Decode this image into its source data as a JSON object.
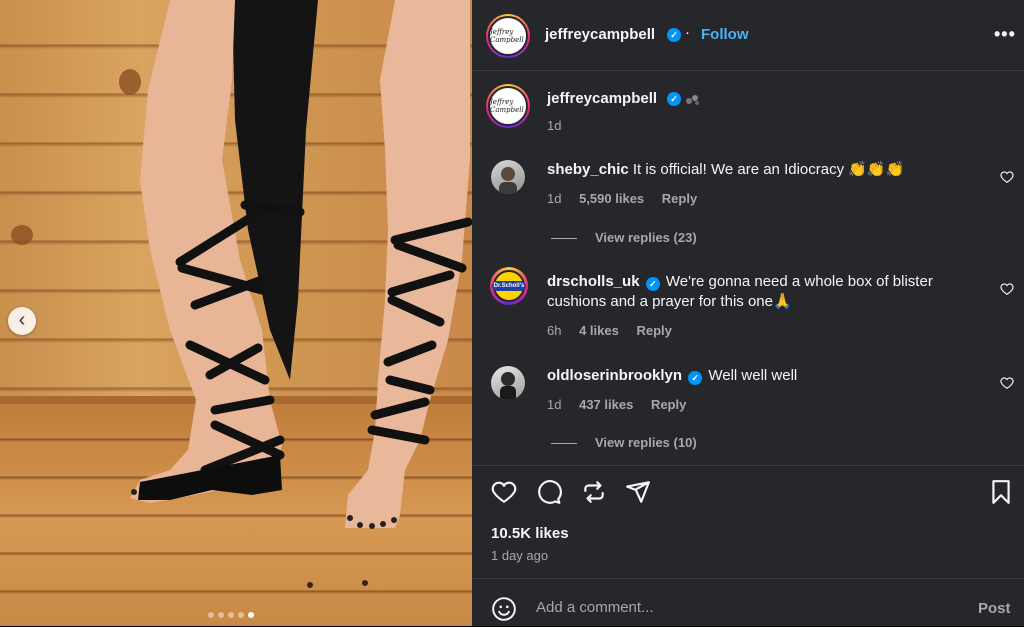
{
  "post": {
    "author": "jeffreycampbell",
    "avatar_text": "Jeffrey Campbell",
    "follow_label": "Follow",
    "separator": "·",
    "more_label": "•••",
    "caption_time": "1d",
    "carousel": {
      "count": 5,
      "active_index": 4
    }
  },
  "comments": [
    {
      "user": "sheby_chic",
      "text": "It is official! We are an Idiocracy 👏👏👏",
      "time": "1d",
      "likes": "5,590 likes",
      "reply_label": "Reply",
      "view_replies": "View replies (23)",
      "verified": false
    },
    {
      "user": "drscholls_uk",
      "avatar_text": "Dr.Scholl's",
      "text": "We're gonna need a whole box of blister cushions and a prayer for this one🙏",
      "time": "6h",
      "likes": "4 likes",
      "reply_label": "Reply",
      "verified": true
    },
    {
      "user": "oldloserinbrooklyn",
      "text": "Well well well",
      "time": "1d",
      "likes": "437 likes",
      "reply_label": "Reply",
      "view_replies": "View replies (10)",
      "verified": true
    }
  ],
  "actions": {
    "like_icon": "heart-icon",
    "comment_icon": "comment-icon",
    "repost_icon": "repost-icon",
    "share_icon": "share-icon",
    "save_icon": "bookmark-icon"
  },
  "stats": {
    "likes": "10.5K likes",
    "posted": "1 day ago"
  },
  "composer": {
    "placeholder": "Add a comment...",
    "post_label": "Post",
    "emoji_icon": "emoji-icon"
  },
  "colors": {
    "accent": "#0095f6",
    "follow": "#4ab3f4",
    "panel": "#25272b"
  }
}
